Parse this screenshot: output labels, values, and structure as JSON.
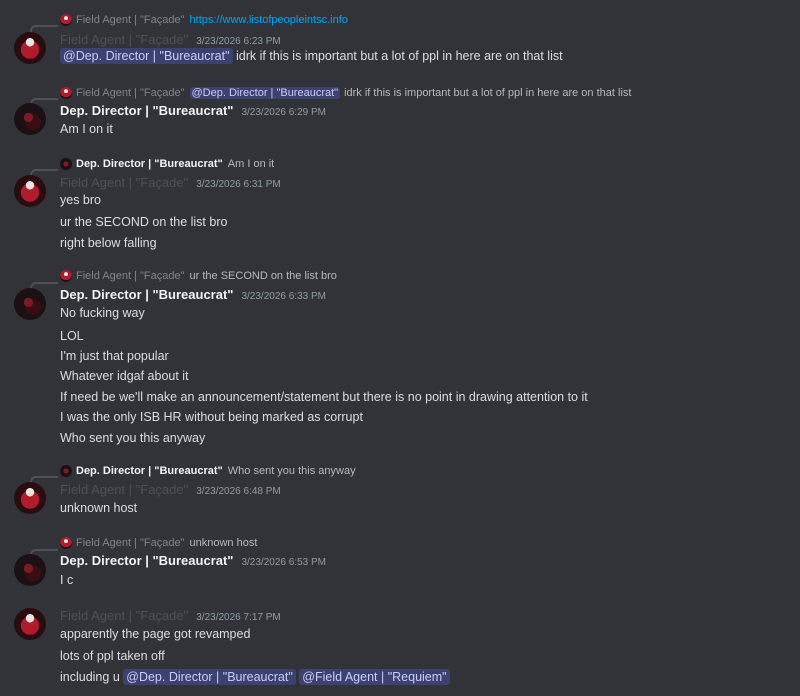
{
  "users": {
    "agent": "Field Agent | \"Façade\"",
    "director": "Dep. Director | \"Bureaucrat\""
  },
  "messages": [
    {
      "reply": {
        "author": "Field Agent | \"Façade\"",
        "text": "https://www.listofpeopleintsc.info"
      },
      "author": "Field Agent | \"Façade\"",
      "timestamp": "3/23/2026 6:23 PM",
      "mention": "@Dep. Director | \"Bureaucrat\"",
      "lines": [
        "idrk if this is important but a lot of ppl in here are on that list"
      ]
    },
    {
      "reply": {
        "author": "Field Agent | \"Façade\"",
        "mention": "@Dep. Director | \"Bureaucrat\"",
        "text": "idrk if this is important but a lot of ppl in here are on that list"
      },
      "author": "Dep. Director | \"Bureaucrat\"",
      "timestamp": "3/23/2026 6:29 PM",
      "lines": [
        "Am I on it"
      ]
    },
    {
      "reply": {
        "author": "Dep. Director | \"Bureaucrat\"",
        "text": "Am I on it"
      },
      "author": "Field Agent | \"Façade\"",
      "timestamp": "3/23/2026 6:31 PM",
      "lines": [
        "yes bro",
        "ur the SECOND on the list bro",
        "right below falling"
      ]
    },
    {
      "reply": {
        "author": "Field Agent | \"Façade\"",
        "text": "ur the SECOND on the list bro"
      },
      "author": "Dep. Director | \"Bureaucrat\"",
      "timestamp": "3/23/2026 6:33 PM",
      "lines": [
        "No fucking way",
        "LOL",
        "I'm just that popular",
        "Whatever idgaf about it",
        "If need be we'll make an announcement/statement but there is no point in drawing attention to it",
        "I was the only ISB HR without being marked as corrupt",
        "Who sent you this anyway"
      ]
    },
    {
      "reply": {
        "author": "Dep. Director | \"Bureaucrat\"",
        "text": "Who sent you this anyway"
      },
      "author": "Field Agent | \"Façade\"",
      "timestamp": "3/23/2026 6:48 PM",
      "lines": [
        "unknown host"
      ]
    },
    {
      "reply": {
        "author": "Field Agent | \"Façade\"",
        "text": "unknown host"
      },
      "author": "Dep. Director | \"Bureaucrat\"",
      "timestamp": "3/23/2026 6:53 PM",
      "lines": [
        "I c"
      ]
    },
    {
      "author": "Field Agent | \"Façade\"",
      "timestamp": "3/23/2026 7:17 PM",
      "lines": [
        "apparently the page got revamped",
        "lots of ppl taken off",
        "including u"
      ],
      "last_mentions": [
        "@Dep. Director | \"Bureaucrat\"",
        "@Field Agent | \"Requiem\""
      ]
    }
  ],
  "colors": {
    "background": "#313338",
    "mention_bg": "#3c4270",
    "mention_text": "#c9cdfb",
    "link": "#00a8fc",
    "agent_name": "#4e5058",
    "director_name": "#f2f3f5"
  }
}
